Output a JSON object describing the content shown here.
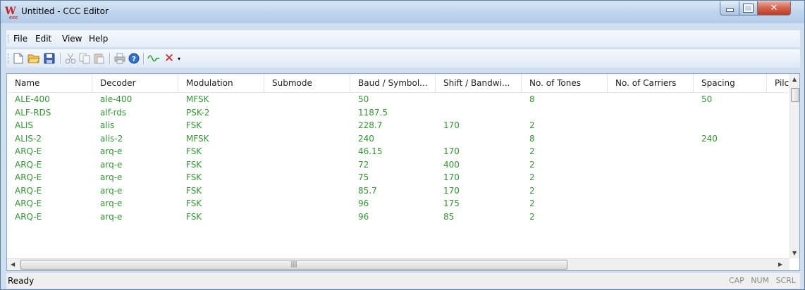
{
  "window": {
    "title": "Untitled - CCC Editor"
  },
  "menu": [
    "File",
    "Edit",
    "View",
    "Help"
  ],
  "toolbar_icons": [
    "new-document-icon",
    "open-folder-icon",
    "save-icon",
    "cut-icon",
    "copy-icon",
    "paste-icon",
    "print-icon",
    "help-icon",
    "waveform-icon",
    "delete-icon",
    "toolbar-overflow-icon"
  ],
  "grid": {
    "columns": [
      "Name",
      "Decoder",
      "Modulation",
      "Submode",
      "Baud / Symbol...",
      "Shift / Bandwi...",
      "No. of Tones",
      "No. of Carriers",
      "Spacing",
      "Pilc"
    ],
    "rows": [
      [
        "ALE-400",
        "ale-400",
        "MFSK",
        "",
        "50",
        "",
        "8",
        "",
        "50",
        ""
      ],
      [
        "ALF-RDS",
        "alf-rds",
        "PSK-2",
        "",
        "1187.5",
        "",
        "",
        "",
        "",
        ""
      ],
      [
        "ALIS",
        "alis",
        "FSK",
        "",
        "228.7",
        "170",
        "2",
        "",
        "",
        ""
      ],
      [
        "ALIS-2",
        "alis-2",
        "MFSK",
        "",
        "240",
        "",
        "8",
        "",
        "240",
        ""
      ],
      [
        "ARQ-E",
        "arq-e",
        "FSK",
        "",
        "46.15",
        "170",
        "2",
        "",
        "",
        ""
      ],
      [
        "ARQ-E",
        "arq-e",
        "FSK",
        "",
        "72",
        "400",
        "2",
        "",
        "",
        ""
      ],
      [
        "ARQ-E",
        "arq-e",
        "FSK",
        "",
        "75",
        "170",
        "2",
        "",
        "",
        ""
      ],
      [
        "ARQ-E",
        "arq-e",
        "FSK",
        "",
        "85.7",
        "170",
        "2",
        "",
        "",
        ""
      ],
      [
        "ARQ-E",
        "arq-e",
        "FSK",
        "",
        "96",
        "175",
        "2",
        "",
        "",
        ""
      ],
      [
        "ARQ-E",
        "arq-e",
        "FSK",
        "",
        "96",
        "85",
        "2",
        "",
        "",
        ""
      ]
    ],
    "text_color": "#2e9a2e"
  },
  "status": {
    "text": "Ready",
    "indicators": [
      "CAP",
      "NUM",
      "SCRL"
    ]
  }
}
